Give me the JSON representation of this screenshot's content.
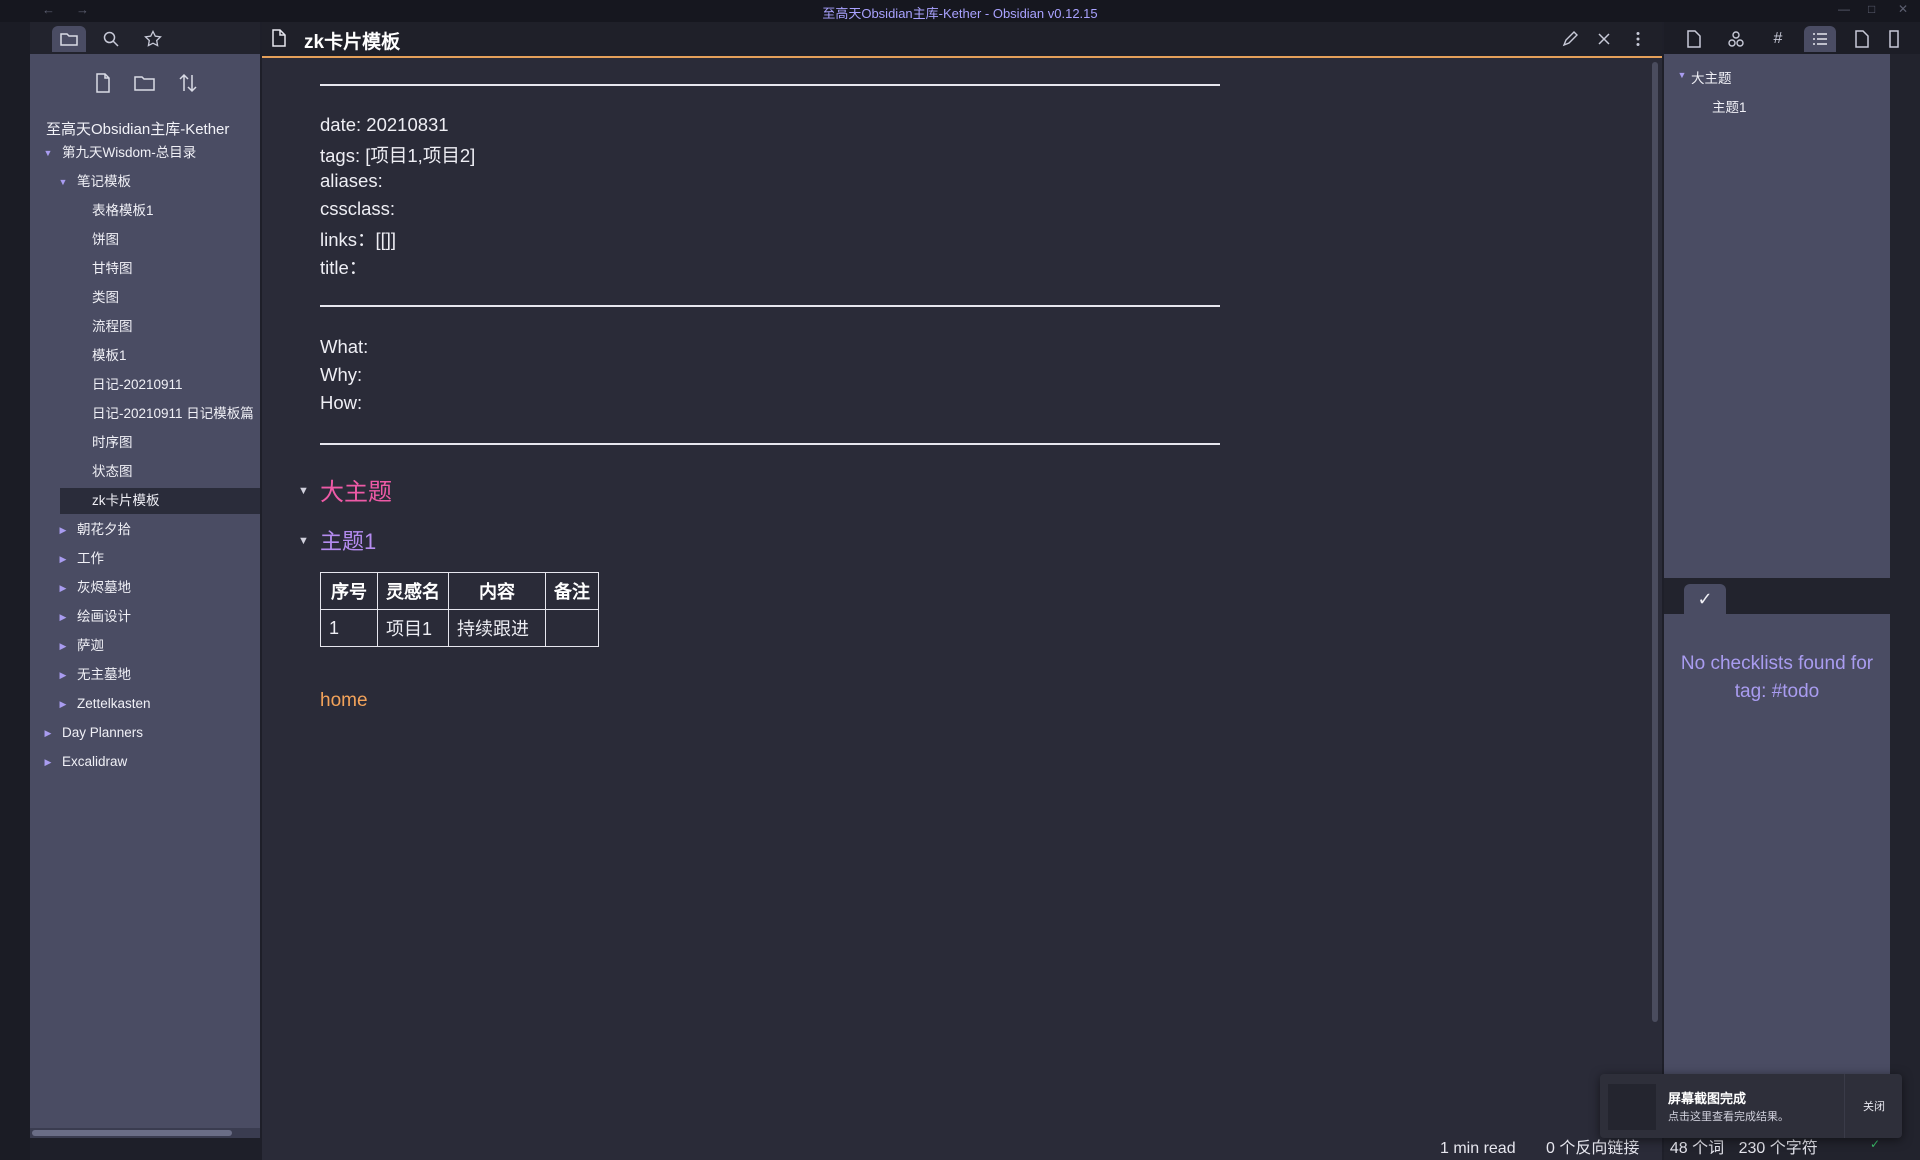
{
  "window": {
    "title": "至高天Obsidian主库-Kether - Obsidian v0.12.15",
    "back": "←",
    "forward": "→",
    "minimize": "—",
    "maximize": "□",
    "close": "✕"
  },
  "left_sidebar": {
    "vault_name": "至高天Obsidian主库-Kether",
    "tree": [
      {
        "label": "第九天Wisdom-总目录",
        "depth": 0,
        "expanded": true
      },
      {
        "label": "笔记模板",
        "depth": 1,
        "expanded": true
      },
      {
        "label": "表格模板1",
        "depth": 2
      },
      {
        "label": "饼图",
        "depth": 2
      },
      {
        "label": "甘特图",
        "depth": 2
      },
      {
        "label": "类图",
        "depth": 2
      },
      {
        "label": "流程图",
        "depth": 2
      },
      {
        "label": "模板1",
        "depth": 2
      },
      {
        "label": "日记-20210911",
        "depth": 2
      },
      {
        "label": "日记-20210911 日记模板篇",
        "depth": 2
      },
      {
        "label": "时序图",
        "depth": 2
      },
      {
        "label": "状态图",
        "depth": 2
      },
      {
        "label": "zk卡片模板",
        "depth": 2,
        "active": true
      },
      {
        "label": "朝花夕拾",
        "depth": 1,
        "expanded": false
      },
      {
        "label": "工作",
        "depth": 1,
        "expanded": false
      },
      {
        "label": "灰烬墓地",
        "depth": 1,
        "expanded": false
      },
      {
        "label": "绘画设计",
        "depth": 1,
        "expanded": false
      },
      {
        "label": "萨迦",
        "depth": 1,
        "expanded": false
      },
      {
        "label": "无主墓地",
        "depth": 1,
        "expanded": false
      },
      {
        "label": "Zettelkasten",
        "depth": 1,
        "expanded": false
      },
      {
        "label": "Day Planners",
        "depth": 0,
        "expanded": false
      },
      {
        "label": "Excalidraw",
        "depth": 0,
        "expanded": false
      }
    ]
  },
  "editor": {
    "file_title": "zk卡片模板",
    "frontmatter": [
      "date: 20210831",
      "tags: [项目1,项目2]",
      "aliases:",
      "cssclass:",
      "links：[[]]",
      "title："
    ],
    "questions": [
      "What:",
      "Why:",
      "How:"
    ],
    "heading1": "大主题",
    "heading2": "主题1",
    "table": {
      "headers": [
        "序号",
        "灵感名",
        "内容",
        "备注"
      ],
      "rows": [
        [
          "1",
          "项目1",
          "持续跟进",
          ""
        ]
      ]
    },
    "link": "home"
  },
  "right_sidebar": {
    "outline": [
      {
        "label": "大主题",
        "level": 1
      },
      {
        "label": "主题1",
        "level": 2
      }
    ],
    "checklist_tab_icon": "✓",
    "checklist_message": "No checklists found for tag: #todo"
  },
  "status_bar": {
    "read_time": "1 min read",
    "backlinks": "0 个反向链接",
    "words": "48 个词",
    "chars": "230 个字符",
    "sync_icon": "✓"
  },
  "toast": {
    "title": "屏幕截图完成",
    "subtitle": "点击这里查看完成结果。",
    "close_label": "关闭"
  },
  "colors": {
    "accent_orange": "#e4a05a",
    "heading1": "#ee5aa6",
    "heading2": "#b58cf0",
    "purple_text": "#a99cf0",
    "link": "#f3a35a"
  }
}
